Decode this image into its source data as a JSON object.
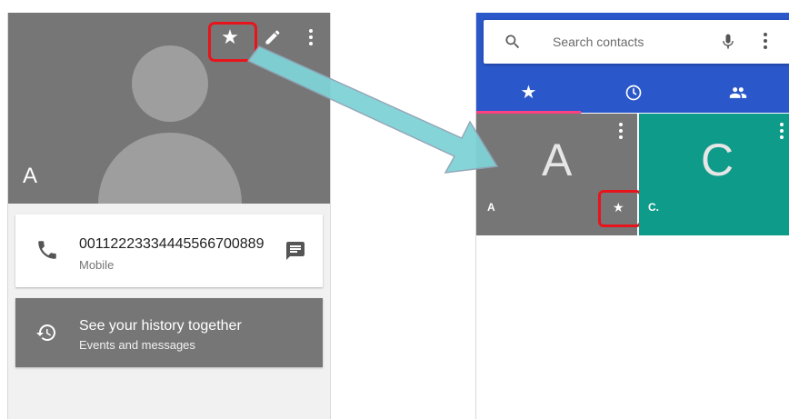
{
  "left_screen": {
    "contact_name": "A",
    "phone_number": "00112223334445566700889",
    "phone_type": "Mobile",
    "history_title": "See your history together",
    "history_subtitle": "Events and messages",
    "icons": [
      "star-icon",
      "edit-icon",
      "more-vert-icon",
      "phone-icon",
      "message-icon",
      "history-icon"
    ]
  },
  "right_screen": {
    "search_placeholder": "Search contacts",
    "tabs": [
      {
        "name": "favorites",
        "icon": "star-icon",
        "selected": true
      },
      {
        "name": "recents",
        "icon": "clock-icon",
        "selected": false
      },
      {
        "name": "contacts",
        "icon": "people-icon",
        "selected": false
      }
    ],
    "favorites": [
      {
        "letter": "A",
        "name": "A",
        "starred": true,
        "tile_color": "#767676"
      },
      {
        "letter": "C",
        "name": "C.",
        "starred": false,
        "tile_color": "#0f9b8a"
      }
    ]
  },
  "colors": {
    "header_gray": "#767676",
    "appbar_blue": "#2a57c9",
    "highlight_red": "#e8141c",
    "arrow_teal": "#7fd3d6",
    "tab_indicator": "#ff4081"
  }
}
